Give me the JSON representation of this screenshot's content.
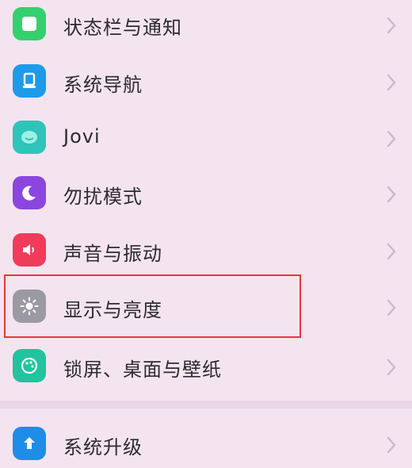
{
  "settings": {
    "items": [
      {
        "label": "状态栏与通知",
        "icon": "notification-icon",
        "color": "#35d06e"
      },
      {
        "label": "系统导航",
        "icon": "navigation-icon",
        "color": "#1e9aea"
      },
      {
        "label": "Jovi",
        "icon": "jovi-icon",
        "color": "#2fc4b9"
      },
      {
        "label": "勿扰模式",
        "icon": "moon-icon",
        "color": "#8b46e0"
      },
      {
        "label": "声音与振动",
        "icon": "speaker-icon",
        "color": "#f03c5a"
      },
      {
        "label": "显示与亮度",
        "icon": "sun-icon",
        "color": "#9b9aa3"
      },
      {
        "label": "锁屏、桌面与壁纸",
        "icon": "wallpaper-icon",
        "color": "#22c39e"
      },
      {
        "label": "系统升级",
        "icon": "upgrade-icon",
        "color": "#1f8de8"
      }
    ],
    "highlight_color": "#e53935"
  }
}
